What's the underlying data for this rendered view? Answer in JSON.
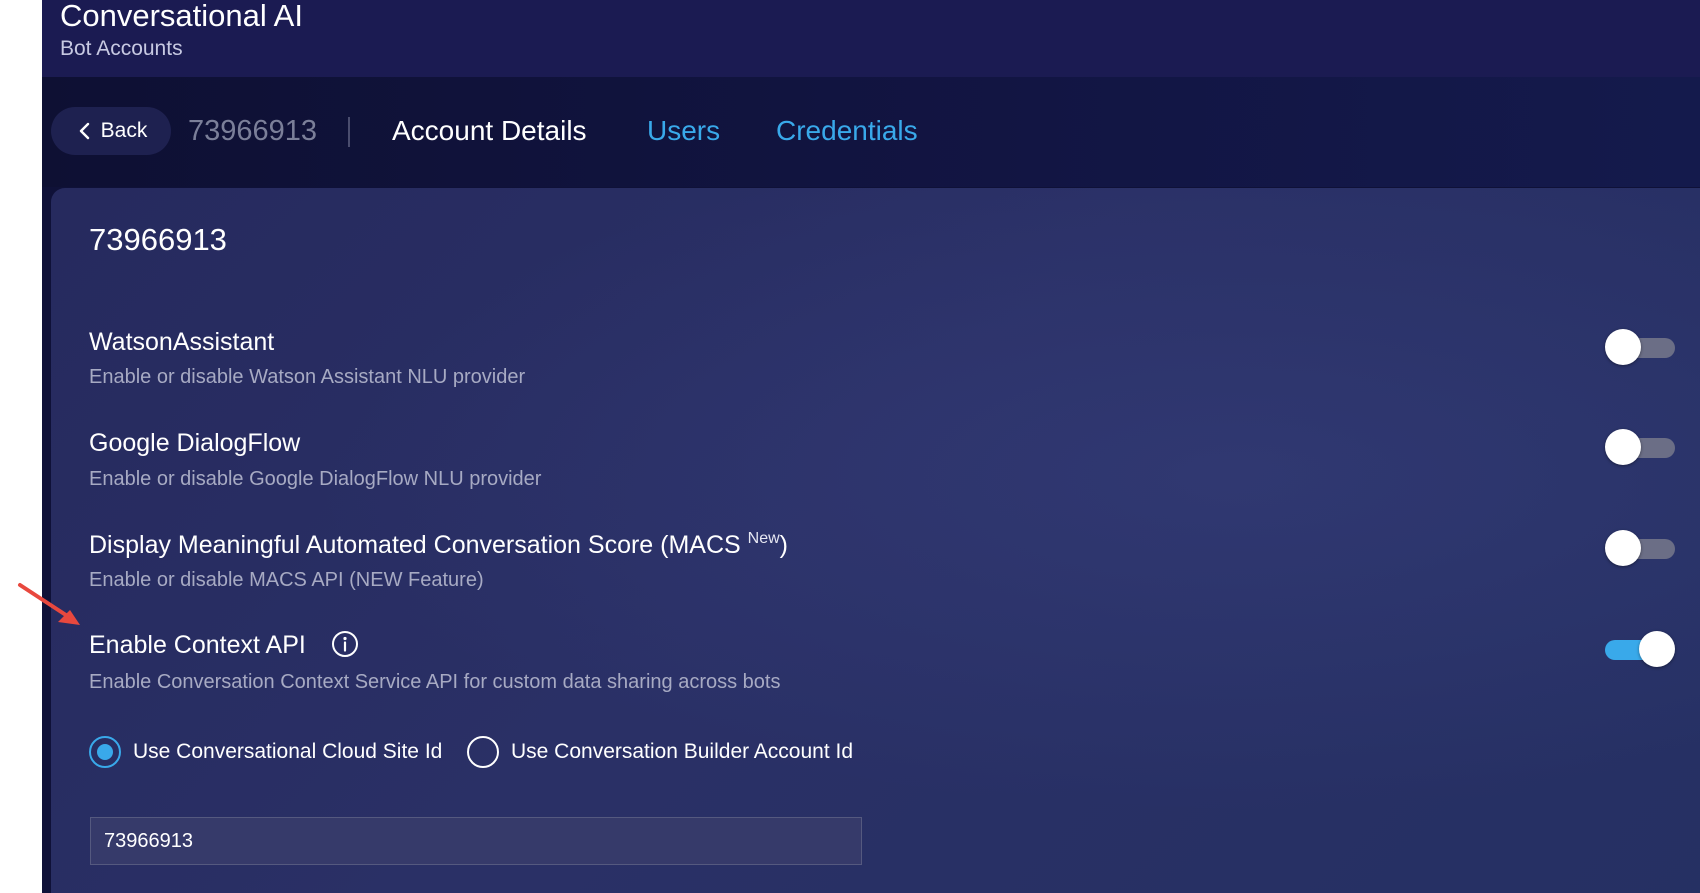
{
  "header": {
    "title": "Conversational AI",
    "subtitle": "Bot Accounts"
  },
  "nav": {
    "back_label": "Back",
    "account_id": "73966913",
    "tabs": [
      {
        "label": "Account Details",
        "active": true
      },
      {
        "label": "Users",
        "active": false
      },
      {
        "label": "Credentials",
        "active": false
      }
    ]
  },
  "panel": {
    "title": "73966913",
    "settings": [
      {
        "title": "WatsonAssistant",
        "description": "Enable or disable Watson Assistant NLU provider",
        "enabled": false
      },
      {
        "title": "Google DialogFlow",
        "description": "Enable or disable Google DialogFlow NLU provider",
        "enabled": false
      },
      {
        "title": "Display Meaningful Automated Conversation Score (MACS ",
        "title_sup": "New",
        "title_suffix": ")",
        "description": "Enable or disable MACS API (NEW Feature)",
        "enabled": false
      },
      {
        "title": "Enable Context API",
        "description": "Enable Conversation Context Service API for custom data sharing across bots",
        "enabled": true
      }
    ],
    "id_source_options": [
      {
        "label": "Use Conversational Cloud Site Id",
        "selected": true
      },
      {
        "label": "Use Conversation Builder Account Id",
        "selected": false
      }
    ],
    "site_id_value": "73966913"
  },
  "colors": {
    "accent": "#39a9ea",
    "background": "#0f1138",
    "panel": "#2a3066",
    "annotation_arrow": "#e8483e"
  },
  "icons": {
    "back": "chevron-left-icon",
    "info": "info-icon",
    "annotation": "red-arrow-icon"
  }
}
